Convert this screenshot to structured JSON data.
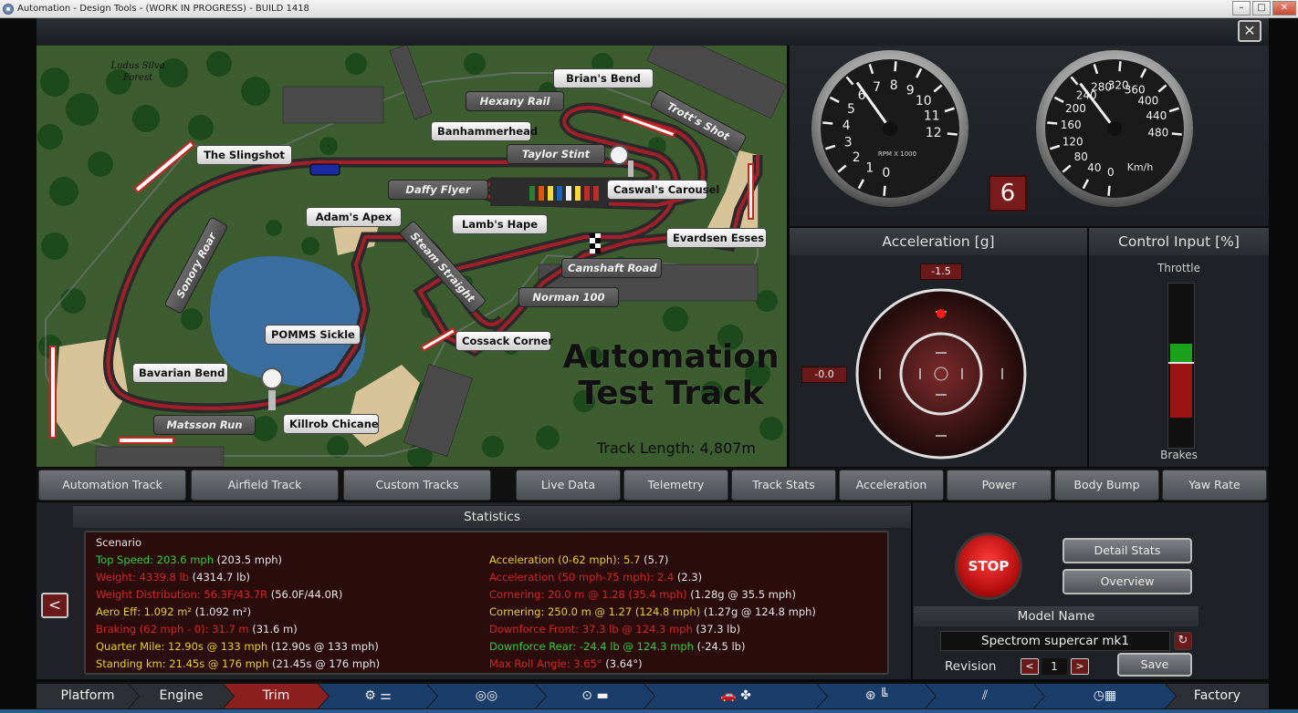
{
  "window": {
    "title": "Automation - Design Tools - (WORK IN PROGRESS) - BUILD 1418",
    "min_glyph": "–",
    "max_glyph": "□",
    "close_glyph": "✕"
  },
  "app_close_glyph": "✕",
  "map": {
    "forest_label": "Ludus Silva Forest",
    "title_line1": "Automation",
    "title_line2": "Test Track",
    "track_length": "Track Length: 4,807m",
    "corners": [
      "Brian's Bend",
      "Hexany Rail",
      "Trott's Shot",
      "Banhammerhead",
      "Taylor Stint",
      "The Slingshot",
      "Caswal's Carousel",
      "Daffy Flyer",
      "Adam's Apex",
      "Lamb's Hape",
      "Evardsen Esses",
      "Sonory Roar",
      "Steam Straight",
      "Camshaft Road",
      "Norman 100",
      "POMMS Sickle",
      "Cossack Corner",
      "Bavarian Bend",
      "Matsson Run",
      "Killrob Chicane"
    ]
  },
  "gauges": {
    "rpm_label": "RPM X 1000",
    "rpm_ticks": [
      "0",
      "1",
      "2",
      "3",
      "4",
      "5",
      "6",
      "7",
      "8",
      "9",
      "10",
      "11",
      "12"
    ],
    "speed_label": "Km/h",
    "speed_ticks": [
      "0",
      "40",
      "80",
      "120",
      "160",
      "200",
      "240",
      "280",
      "320",
      "360",
      "400",
      "440",
      "480"
    ],
    "rpm_value": 6.2,
    "speed_value": 245,
    "gear": "6"
  },
  "acceleration": {
    "title": "Acceleration [g]",
    "longitudinal": "-1.5",
    "lateral": "-0.0"
  },
  "control_input": {
    "title": "Control Input [%]",
    "throttle_label": "Throttle",
    "brakes_label": "Brakes",
    "throttle_fraction": 0.11,
    "brake_fraction": 0.33
  },
  "track_tabs": [
    "Automation Track",
    "Airfield Track",
    "Custom Tracks"
  ],
  "data_tabs": [
    "Live Data",
    "Telemetry",
    "Track Stats",
    "Acceleration",
    "Power",
    "Body Bump",
    "Yaw Rate"
  ],
  "statistics": {
    "title": "Statistics",
    "scenario": "Scenario",
    "left": [
      {
        "label": "Top Speed: 203.6 mph",
        "ref": " (203.5 mph)",
        "color": "green"
      },
      {
        "label": "Weight: 4339.8 lb",
        "ref": " (4314.7 lb)",
        "color": "red"
      },
      {
        "label": "Weight Distribution: 56.3F/43.7R",
        "ref": " (56.0F/44.0R)",
        "color": "red"
      },
      {
        "label": "Aero Eff: 1.092 m²",
        "ref": " (1.092 m²)",
        "color": "yellow"
      },
      {
        "label": "Braking (62 mph - 0): 31.7 m",
        "ref": " (31.6 m)",
        "color": "red"
      },
      {
        "label": "Quarter Mile: 12.90s @ 133 mph",
        "ref": " (12.90s @ 133 mph)",
        "color": "yellow"
      },
      {
        "label": "Standing km: 21.45s @ 176 mph",
        "ref": " (21.45s @ 176 mph)",
        "color": "yellow"
      }
    ],
    "right": [
      {
        "label": "Acceleration (0-62 mph): 5.7",
        "ref": " (5.7)",
        "color": "yellow"
      },
      {
        "label": "Acceleration (50 mph-75 mph): 2.4",
        "ref": " (2.3)",
        "color": "red"
      },
      {
        "label": "Cornering: 20.0 m @ 1.28 (35.4 mph)",
        "ref": " (1.28g @ 35.5 mph)",
        "color": "red"
      },
      {
        "label": "Cornering: 250.0 m @ 1.27 (124.8 mph)",
        "ref": " (1.27g @ 124.8 mph)",
        "color": "yellow"
      },
      {
        "label": "Downforce Front: 37.3 lb @ 124.3 mph",
        "ref": " (37.3 lb)",
        "color": "red"
      },
      {
        "label": "Downforce Rear: -24.4 lb @ 124.3 mph",
        "ref": " (-24.5 lb)",
        "color": "green"
      },
      {
        "label": "Max Roll Angle: 3.65°",
        "ref": " (3.64°)",
        "color": "red"
      }
    ],
    "prev_glyph": "<",
    "next_glyph": ">"
  },
  "controls": {
    "stop": "STOP",
    "detail_stats": "Detail Stats",
    "overview": "Overview",
    "model_name_title": "Model Name",
    "model_name": "Spectrom supercar mk1",
    "revision_label": "Revision",
    "revision": "1",
    "rev_prev": "<",
    "rev_next": ">",
    "save": "Save",
    "refresh_glyph": "↻"
  },
  "bottom_nav": [
    "Platform",
    "Engine",
    "Trim",
    "",
    "",
    "",
    "",
    "",
    "",
    "",
    "Factory"
  ],
  "colors": {
    "accent_red": "#6b1a1a",
    "nav_active": "#8c1f1f",
    "nav_blue": "#1a3d6a"
  }
}
